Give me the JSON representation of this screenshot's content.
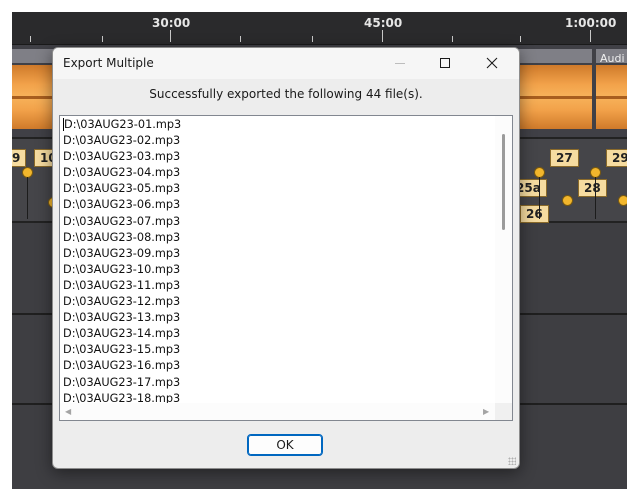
{
  "background": {
    "ruler_labels": [
      "30:00",
      "45:00",
      "1:00:00"
    ],
    "clip_label": "Audi",
    "labels": [
      "9",
      "10",
      "27",
      "29",
      "28",
      "25a",
      "26"
    ]
  },
  "dialog": {
    "title": "Export Multiple",
    "message": "Successfully exported the following 44 file(s).",
    "files": [
      "D:\\03AUG23-01.mp3",
      "D:\\03AUG23-02.mp3",
      "D:\\03AUG23-03.mp3",
      "D:\\03AUG23-04.mp3",
      "D:\\03AUG23-05.mp3",
      "D:\\03AUG23-06.mp3",
      "D:\\03AUG23-07.mp3",
      "D:\\03AUG23-08.mp3",
      "D:\\03AUG23-09.mp3",
      "D:\\03AUG23-10.mp3",
      "D:\\03AUG23-11.mp3",
      "D:\\03AUG23-12.mp3",
      "D:\\03AUG23-13.mp3",
      "D:\\03AUG23-14.mp3",
      "D:\\03AUG23-15.mp3",
      "D:\\03AUG23-16.mp3",
      "D:\\03AUG23-17.mp3",
      "D:\\03AUG23-18.mp3"
    ],
    "ok_label": "OK"
  }
}
